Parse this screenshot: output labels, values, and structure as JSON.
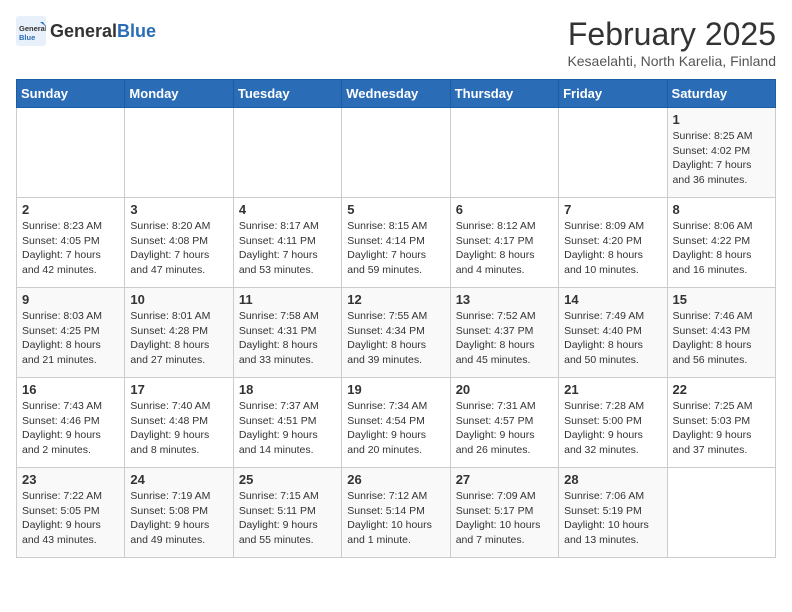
{
  "header": {
    "logo_general": "General",
    "logo_blue": "Blue",
    "month_title": "February 2025",
    "subtitle": "Kesaelahti, North Karelia, Finland"
  },
  "weekdays": [
    "Sunday",
    "Monday",
    "Tuesday",
    "Wednesday",
    "Thursday",
    "Friday",
    "Saturday"
  ],
  "weeks": [
    [
      {
        "day": "",
        "info": ""
      },
      {
        "day": "",
        "info": ""
      },
      {
        "day": "",
        "info": ""
      },
      {
        "day": "",
        "info": ""
      },
      {
        "day": "",
        "info": ""
      },
      {
        "day": "",
        "info": ""
      },
      {
        "day": "1",
        "info": "Sunrise: 8:25 AM\nSunset: 4:02 PM\nDaylight: 7 hours and 36 minutes."
      }
    ],
    [
      {
        "day": "2",
        "info": "Sunrise: 8:23 AM\nSunset: 4:05 PM\nDaylight: 7 hours and 42 minutes."
      },
      {
        "day": "3",
        "info": "Sunrise: 8:20 AM\nSunset: 4:08 PM\nDaylight: 7 hours and 47 minutes."
      },
      {
        "day": "4",
        "info": "Sunrise: 8:17 AM\nSunset: 4:11 PM\nDaylight: 7 hours and 53 minutes."
      },
      {
        "day": "5",
        "info": "Sunrise: 8:15 AM\nSunset: 4:14 PM\nDaylight: 7 hours and 59 minutes."
      },
      {
        "day": "6",
        "info": "Sunrise: 8:12 AM\nSunset: 4:17 PM\nDaylight: 8 hours and 4 minutes."
      },
      {
        "day": "7",
        "info": "Sunrise: 8:09 AM\nSunset: 4:20 PM\nDaylight: 8 hours and 10 minutes."
      },
      {
        "day": "8",
        "info": "Sunrise: 8:06 AM\nSunset: 4:22 PM\nDaylight: 8 hours and 16 minutes."
      }
    ],
    [
      {
        "day": "9",
        "info": "Sunrise: 8:03 AM\nSunset: 4:25 PM\nDaylight: 8 hours and 21 minutes."
      },
      {
        "day": "10",
        "info": "Sunrise: 8:01 AM\nSunset: 4:28 PM\nDaylight: 8 hours and 27 minutes."
      },
      {
        "day": "11",
        "info": "Sunrise: 7:58 AM\nSunset: 4:31 PM\nDaylight: 8 hours and 33 minutes."
      },
      {
        "day": "12",
        "info": "Sunrise: 7:55 AM\nSunset: 4:34 PM\nDaylight: 8 hours and 39 minutes."
      },
      {
        "day": "13",
        "info": "Sunrise: 7:52 AM\nSunset: 4:37 PM\nDaylight: 8 hours and 45 minutes."
      },
      {
        "day": "14",
        "info": "Sunrise: 7:49 AM\nSunset: 4:40 PM\nDaylight: 8 hours and 50 minutes."
      },
      {
        "day": "15",
        "info": "Sunrise: 7:46 AM\nSunset: 4:43 PM\nDaylight: 8 hours and 56 minutes."
      }
    ],
    [
      {
        "day": "16",
        "info": "Sunrise: 7:43 AM\nSunset: 4:46 PM\nDaylight: 9 hours and 2 minutes."
      },
      {
        "day": "17",
        "info": "Sunrise: 7:40 AM\nSunset: 4:48 PM\nDaylight: 9 hours and 8 minutes."
      },
      {
        "day": "18",
        "info": "Sunrise: 7:37 AM\nSunset: 4:51 PM\nDaylight: 9 hours and 14 minutes."
      },
      {
        "day": "19",
        "info": "Sunrise: 7:34 AM\nSunset: 4:54 PM\nDaylight: 9 hours and 20 minutes."
      },
      {
        "day": "20",
        "info": "Sunrise: 7:31 AM\nSunset: 4:57 PM\nDaylight: 9 hours and 26 minutes."
      },
      {
        "day": "21",
        "info": "Sunrise: 7:28 AM\nSunset: 5:00 PM\nDaylight: 9 hours and 32 minutes."
      },
      {
        "day": "22",
        "info": "Sunrise: 7:25 AM\nSunset: 5:03 PM\nDaylight: 9 hours and 37 minutes."
      }
    ],
    [
      {
        "day": "23",
        "info": "Sunrise: 7:22 AM\nSunset: 5:05 PM\nDaylight: 9 hours and 43 minutes."
      },
      {
        "day": "24",
        "info": "Sunrise: 7:19 AM\nSunset: 5:08 PM\nDaylight: 9 hours and 49 minutes."
      },
      {
        "day": "25",
        "info": "Sunrise: 7:15 AM\nSunset: 5:11 PM\nDaylight: 9 hours and 55 minutes."
      },
      {
        "day": "26",
        "info": "Sunrise: 7:12 AM\nSunset: 5:14 PM\nDaylight: 10 hours and 1 minute."
      },
      {
        "day": "27",
        "info": "Sunrise: 7:09 AM\nSunset: 5:17 PM\nDaylight: 10 hours and 7 minutes."
      },
      {
        "day": "28",
        "info": "Sunrise: 7:06 AM\nSunset: 5:19 PM\nDaylight: 10 hours and 13 minutes."
      },
      {
        "day": "",
        "info": ""
      }
    ]
  ]
}
